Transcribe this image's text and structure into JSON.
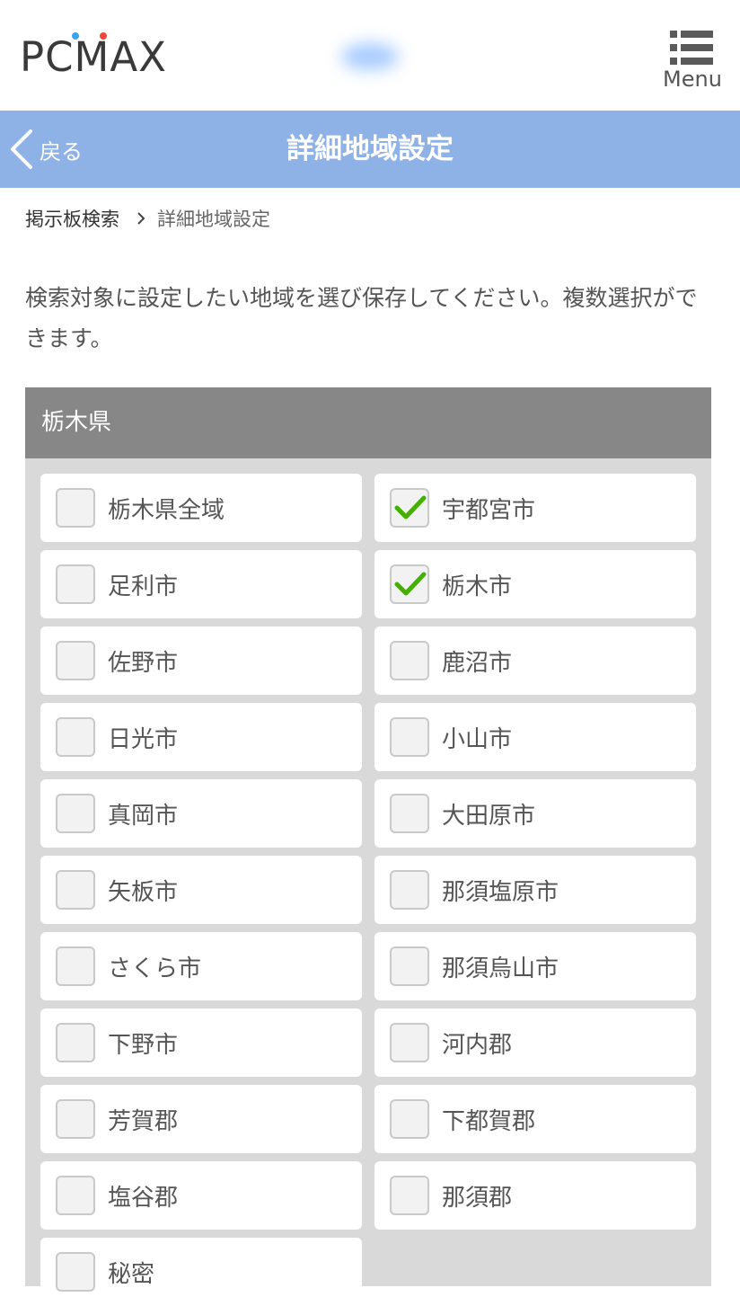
{
  "header": {
    "logo_text": "PCMAX",
    "menu_label": "Menu",
    "colors": {
      "dot_blue": "#3aa4ec",
      "dot_red": "#f0463c"
    }
  },
  "title_bar": {
    "back_label": "戻る",
    "title": "詳細地域設定",
    "color": "#8fb2e6"
  },
  "breadcrumb": {
    "parent": "掲示板検索",
    "current": "詳細地域設定"
  },
  "description": "検索対象に設定したい地域を選び保存してください。複数選択ができます。",
  "section": {
    "title": "栃木県",
    "items": [
      {
        "label": "栃木県全域",
        "checked": false
      },
      {
        "label": "宇都宮市",
        "checked": true
      },
      {
        "label": "足利市",
        "checked": false
      },
      {
        "label": "栃木市",
        "checked": true
      },
      {
        "label": "佐野市",
        "checked": false
      },
      {
        "label": "鹿沼市",
        "checked": false
      },
      {
        "label": "日光市",
        "checked": false
      },
      {
        "label": "小山市",
        "checked": false
      },
      {
        "label": "真岡市",
        "checked": false
      },
      {
        "label": "大田原市",
        "checked": false
      },
      {
        "label": "矢板市",
        "checked": false
      },
      {
        "label": "那須塩原市",
        "checked": false
      },
      {
        "label": "さくら市",
        "checked": false
      },
      {
        "label": "那須烏山市",
        "checked": false
      },
      {
        "label": "下野市",
        "checked": false
      },
      {
        "label": "河内郡",
        "checked": false
      },
      {
        "label": "芳賀郡",
        "checked": false
      },
      {
        "label": "下都賀郡",
        "checked": false
      },
      {
        "label": "塩谷郡",
        "checked": false
      },
      {
        "label": "那須郡",
        "checked": false
      },
      {
        "label": "秘密",
        "checked": false
      }
    ]
  },
  "icons": {
    "menu": "menu-list-icon",
    "back": "chevron-left-icon",
    "breadcrumb_separator": "chevron-right-icon",
    "check": "checkmark-icon"
  },
  "check_color": "#44b000"
}
